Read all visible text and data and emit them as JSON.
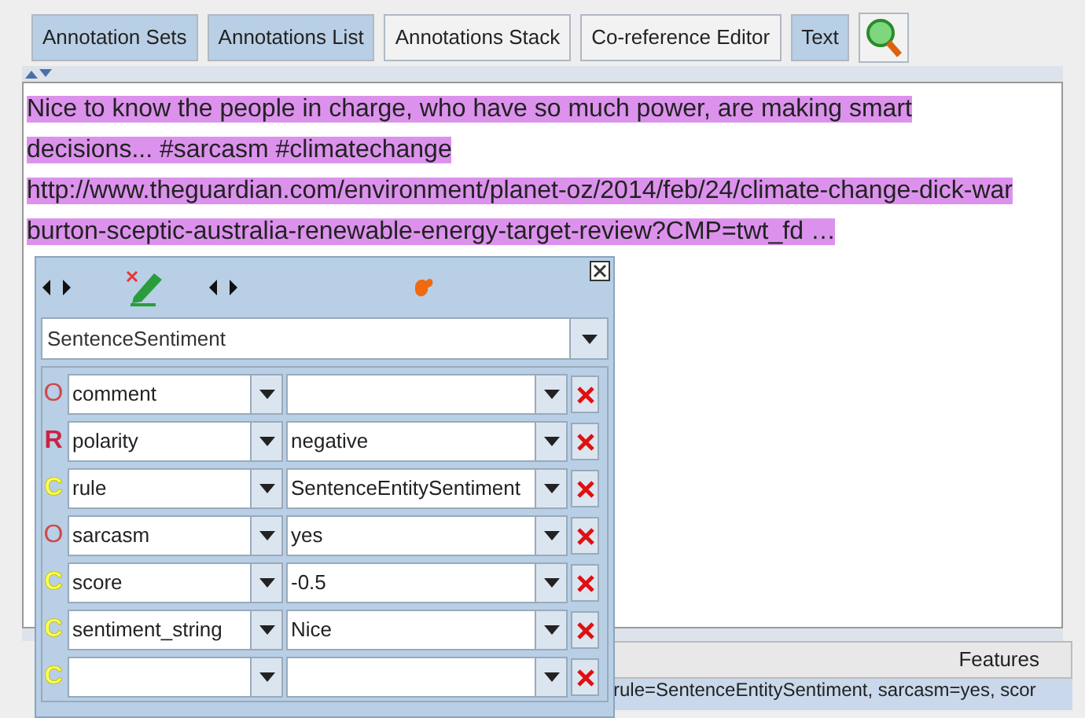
{
  "toolbar": {
    "buttons": [
      {
        "label": "Annotation Sets",
        "selected": true
      },
      {
        "label": "Annotations List",
        "selected": true
      },
      {
        "label": "Annotations Stack",
        "selected": false
      },
      {
        "label": "Co-reference Editor",
        "selected": false
      },
      {
        "label": "Text",
        "selected": true
      }
    ]
  },
  "text_lines": [
    "Nice to know the people in charge, who have so much power, are making smart",
    "decisions... #sarcasm #climatechange",
    "http://www.theguardian.com/environment/planet-oz/2014/feb/24/climate-change-dick-war",
    "burton-sceptic-australia-renewable-energy-target-review?CMP=twt_fd …"
  ],
  "editor": {
    "annotation_type": "SentenceSentiment",
    "features": [
      {
        "kind": "optional",
        "marker": "O",
        "name": "comment"
      },
      {
        "kind": "required",
        "marker": "R",
        "name": "polarity",
        "value": "negative"
      },
      {
        "kind": "custom",
        "marker": "C",
        "name": "rule",
        "value": "SentenceEntitySentiment"
      },
      {
        "kind": "optional",
        "marker": "O",
        "name": "sarcasm",
        "value": "yes"
      },
      {
        "kind": "custom",
        "marker": "C",
        "name": "score",
        "value": "-0.5"
      },
      {
        "kind": "custom",
        "marker": "C",
        "name": "sentiment_string",
        "value": "Nice"
      },
      {
        "kind": "custom",
        "marker": "C"
      }
    ]
  },
  "table": {
    "header": "Features",
    "row_features": "rule=SentenceEntitySentiment, sarcasm=yes, scor"
  }
}
